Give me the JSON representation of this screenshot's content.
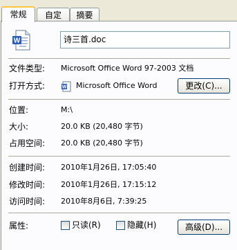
{
  "tabs": [
    {
      "label": "常规",
      "active": true
    },
    {
      "label": "自定义",
      "active": false
    },
    {
      "label": "摘要",
      "active": false
    }
  ],
  "file": {
    "name": "诗三首.doc",
    "icon": "word-document-icon"
  },
  "rows": {
    "type_label": "文件类型:",
    "type_value": "Microsoft Office Word 97-2003 文档",
    "open_label": "打开方式:",
    "open_value": "Microsoft Office Word",
    "change_button": "更改(C)...",
    "location_label": "位置:",
    "location_value": "M:\\",
    "size_label": "大小:",
    "size_value": "20.0 KB (20,480 字节)",
    "disk_label": "占用空间:",
    "disk_value": "20.0 KB (20,480 字节)",
    "created_label": "创建时间:",
    "created_value": "2010年1月26日, 17:05:40",
    "modified_label": "修改时间:",
    "modified_value": "2010年1月26日, 17:15:12",
    "accessed_label": "访问时间:",
    "accessed_value": "2010年8月6日, 7:39:25",
    "attr_label": "属性:",
    "readonly_label": "只读(R)",
    "hidden_label": "隐藏(H)",
    "advanced_button": "高级(D)..."
  },
  "colors": {
    "tab_highlight": "#ffc83c",
    "panel_bg": "#fcfcfe",
    "window_bg": "#ece9d8"
  }
}
